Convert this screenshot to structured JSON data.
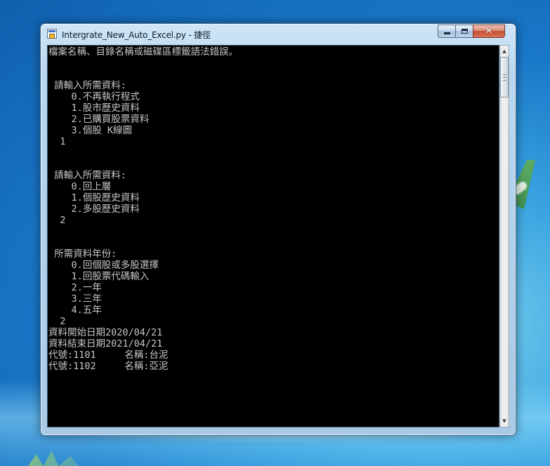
{
  "window": {
    "title": "Intergrate_New_Auto_Excel.py - 捷徑",
    "icon": "python-shortcut-icon",
    "controls": {
      "minimize": "minimize-icon",
      "maximize": "maximize-icon",
      "close": "close-icon"
    }
  },
  "console": {
    "lines": [
      "檔案名稱、目錄名稱或磁碟區標籤語法錯誤。",
      "",
      "",
      " 請輸入所需資料:",
      "    0.不再執行程式",
      "    1.股市歷史資料",
      "    2.已購買股票資料",
      "    3.個股 K線圖",
      "  1",
      "",
      "",
      " 請輸入所需資料:",
      "    0.回上層",
      "    1.個股歷史資料",
      "    2.多股歷史資料",
      "  2",
      "",
      "",
      " 所需資料年份:",
      "    0.回個股或多股選擇",
      "    1.回股票代碼輸入",
      "    2.一年",
      "    3.三年",
      "    4.五年",
      "  2",
      "資料開始日期2020/04/21",
      "資料結束日期2021/04/21",
      "代號:1101     名稱:台泥",
      "代號:1102     名稱:亞泥"
    ]
  },
  "scrollbar": {
    "up": "scroll-up-arrow-icon",
    "down": "scroll-down-arrow-icon"
  },
  "colors": {
    "console_bg": "#000000",
    "console_text": "#c6c6c6",
    "title_bar": "#b9d7ef",
    "close_button": "#c4502f"
  }
}
